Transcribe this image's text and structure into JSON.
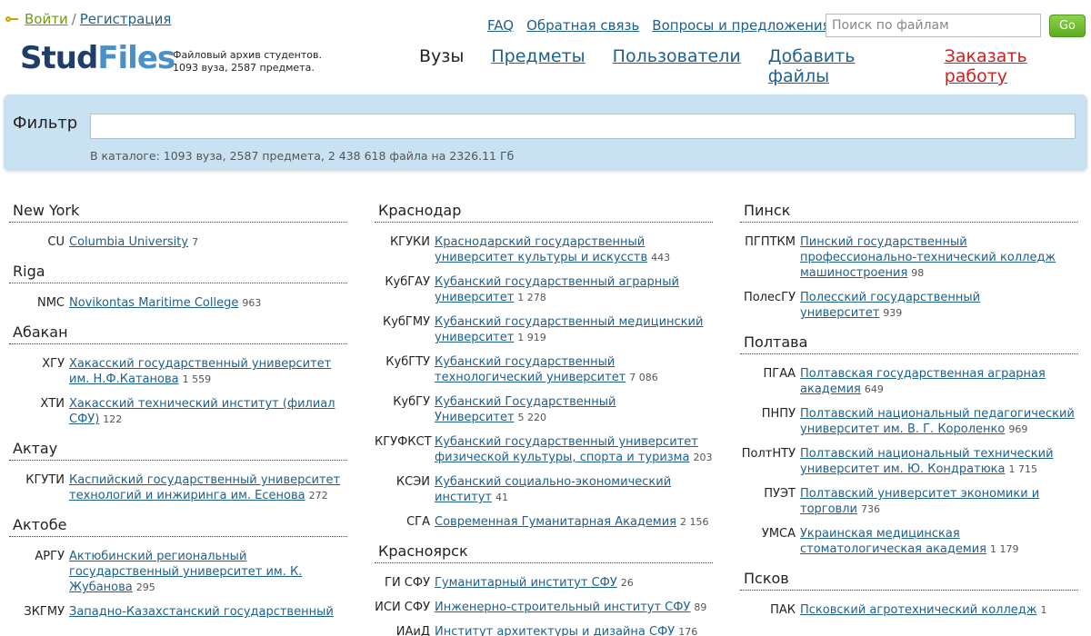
{
  "auth": {
    "login": "Войти",
    "sep": "/",
    "register": "Регистрация"
  },
  "toplinks": [
    "FAQ",
    "Обратная связь",
    "Вопросы и предложения"
  ],
  "search": {
    "placeholder": "Поиск по файлам",
    "button": "Go"
  },
  "logo": {
    "part1": "Stud",
    "part2": "Files"
  },
  "tagline": {
    "line1": "Файловый архив студентов.",
    "line2": "1093 вуза, 2587 предмета."
  },
  "nav": {
    "vuzy": "Вузы",
    "predmety": "Предметы",
    "users": "Пользователи",
    "add": "Добавить файлы",
    "order": "Заказать работу"
  },
  "filter": {
    "label": "Фильтр",
    "stats": "В каталоге: 1093 вуза, 2587 предмета, 2 438 618 файла на 2326.11 Гб"
  },
  "columns": [
    [
      {
        "city": "New York",
        "unis": [
          {
            "abbr": "CU",
            "name": "Columbia University",
            "count": "7"
          }
        ]
      },
      {
        "city": "Riga",
        "unis": [
          {
            "abbr": "NMC",
            "name": "Novikontas Maritime College",
            "count": "963"
          }
        ]
      },
      {
        "city": "Абакан",
        "unis": [
          {
            "abbr": "ХГУ",
            "name": "Хакасский государственный университет им. Н.Ф.Катанова",
            "count": "1 559"
          },
          {
            "abbr": "ХТИ",
            "name": "Хакасский технический институт (филиал СФУ)",
            "count": "122"
          }
        ]
      },
      {
        "city": "Актау",
        "unis": [
          {
            "abbr": "КГУТИ",
            "name": "Каспийский государственный университет технологий и инжиринга им. Есенова",
            "count": "272"
          }
        ]
      },
      {
        "city": "Актобе",
        "unis": [
          {
            "abbr": "АРГУ",
            "name": "Актюбинский региональный государственный университет им. К. Жубанова",
            "count": "295"
          },
          {
            "abbr": "ЗКГМУ",
            "name": "Западно-Казахстанский государственный",
            "count": ""
          }
        ]
      }
    ],
    [
      {
        "city": "Краснодар",
        "unis": [
          {
            "abbr": "КГУКИ",
            "name": "Краснодарский государственный университет культуры и искусств",
            "count": "443"
          },
          {
            "abbr": "КубГАУ",
            "name": "Кубанский государственный аграрный университет",
            "count": "1 278"
          },
          {
            "abbr": "КубГМУ",
            "name": "Кубанский государственный медицинский университет",
            "count": "1 919"
          },
          {
            "abbr": "КубГТУ",
            "name": "Кубанский государственный технологический университет",
            "count": "7 086"
          },
          {
            "abbr": "КубГУ",
            "name": "Кубанский Государственный Университет",
            "count": "5 220"
          },
          {
            "abbr": "КГУФКСТ",
            "name": "Кубанский государственный университет физической культуры, спорта и туризма",
            "count": "203"
          },
          {
            "abbr": "КСЭИ",
            "name": "Кубанский социально-экономический институт",
            "count": "41"
          },
          {
            "abbr": "СГА",
            "name": "Современная Гуманитарная Академия",
            "count": "2 156"
          }
        ]
      },
      {
        "city": "Красноярск",
        "unis": [
          {
            "abbr": "ГИ СФУ",
            "name": "Гуманитарный институт СФУ",
            "count": "26"
          },
          {
            "abbr": "ИСИ СФУ",
            "name": "Инженерно-строительный институт СФУ",
            "count": "89"
          },
          {
            "abbr": "ИАиД",
            "name": "Институт архитектуры и дизайна СФУ",
            "count": "176"
          }
        ]
      }
    ],
    [
      {
        "city": "Пинск",
        "unis": [
          {
            "abbr": "ПГПТКМ",
            "name": "Пинский государственный профессионально-технический колледж машиностроения",
            "count": "98"
          },
          {
            "abbr": "ПолесГУ",
            "name": "Полесский государственный университет",
            "count": "939"
          }
        ]
      },
      {
        "city": "Полтава",
        "unis": [
          {
            "abbr": "ПГАА",
            "name": "Полтавская государственная аграрная академия",
            "count": "649"
          },
          {
            "abbr": "ПНПУ",
            "name": "Полтавский национальный педагогический университет им. В. Г. Короленко",
            "count": "969"
          },
          {
            "abbr": "ПолтНТУ",
            "name": "Полтавский национальный технический университет им. Ю. Кондратюка",
            "count": "1 715"
          },
          {
            "abbr": "ПУЭТ",
            "name": "Полтавский университет экономики и торговли",
            "count": "736"
          },
          {
            "abbr": "УМСА",
            "name": "Украинская медицинская стоматологическая академия",
            "count": "1 179"
          }
        ]
      },
      {
        "city": "Псков",
        "unis": [
          {
            "abbr": "ПАК",
            "name": "Псковский агротехнический колледж",
            "count": "1"
          }
        ]
      }
    ]
  ]
}
